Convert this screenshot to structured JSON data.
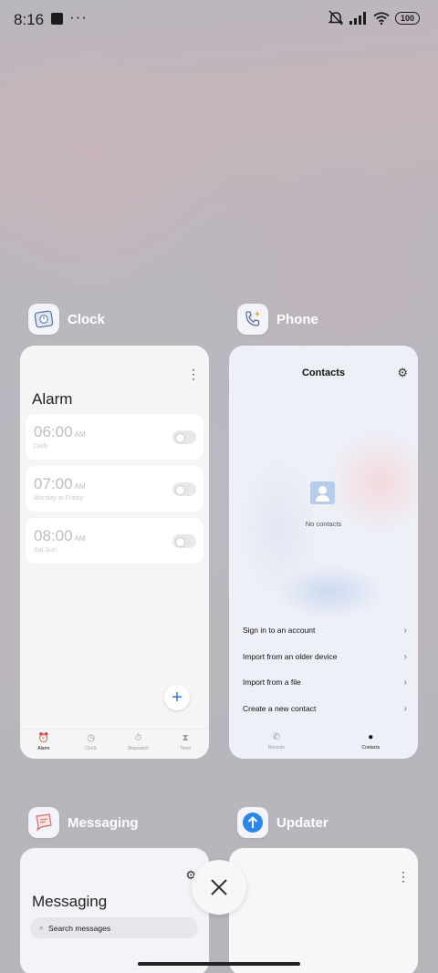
{
  "status_bar": {
    "time": "8:16",
    "battery": "100"
  },
  "recents": {
    "clock": {
      "app_name": "Clock",
      "title": "Alarm",
      "alarms": [
        {
          "time": "06:00",
          "ampm": "AM",
          "repeat": "Daily",
          "enabled": false
        },
        {
          "time": "07:00",
          "ampm": "AM",
          "repeat": "Monday to Friday",
          "enabled": false
        },
        {
          "time": "08:00",
          "ampm": "AM",
          "repeat": "Sat Sun",
          "enabled": false
        }
      ],
      "add_label": "+",
      "nav": [
        {
          "label": "Alarm",
          "icon": "alarm-icon",
          "active": true
        },
        {
          "label": "Clock",
          "icon": "clock-icon",
          "active": false
        },
        {
          "label": "Stopwatch",
          "icon": "stopwatch-icon",
          "active": false
        },
        {
          "label": "Timer",
          "icon": "hourglass-icon",
          "active": false
        }
      ]
    },
    "phone": {
      "app_name": "Phone",
      "title": "Contacts",
      "empty_text": "No contacts",
      "options": [
        "Sign in to an account",
        "Import from an older device",
        "Import from a file",
        "Create a new contact"
      ],
      "nav": [
        {
          "label": "Recents",
          "icon": "phone-icon",
          "active": false
        },
        {
          "label": "Contacts",
          "icon": "person-icon",
          "active": true
        }
      ]
    },
    "messaging": {
      "app_name": "Messaging",
      "title": "Messaging",
      "search_placeholder": "Search messages"
    },
    "updater": {
      "app_name": "Updater"
    }
  },
  "colors": {
    "accent": "#2a7be4",
    "updater_icon": "#2a86e8"
  }
}
